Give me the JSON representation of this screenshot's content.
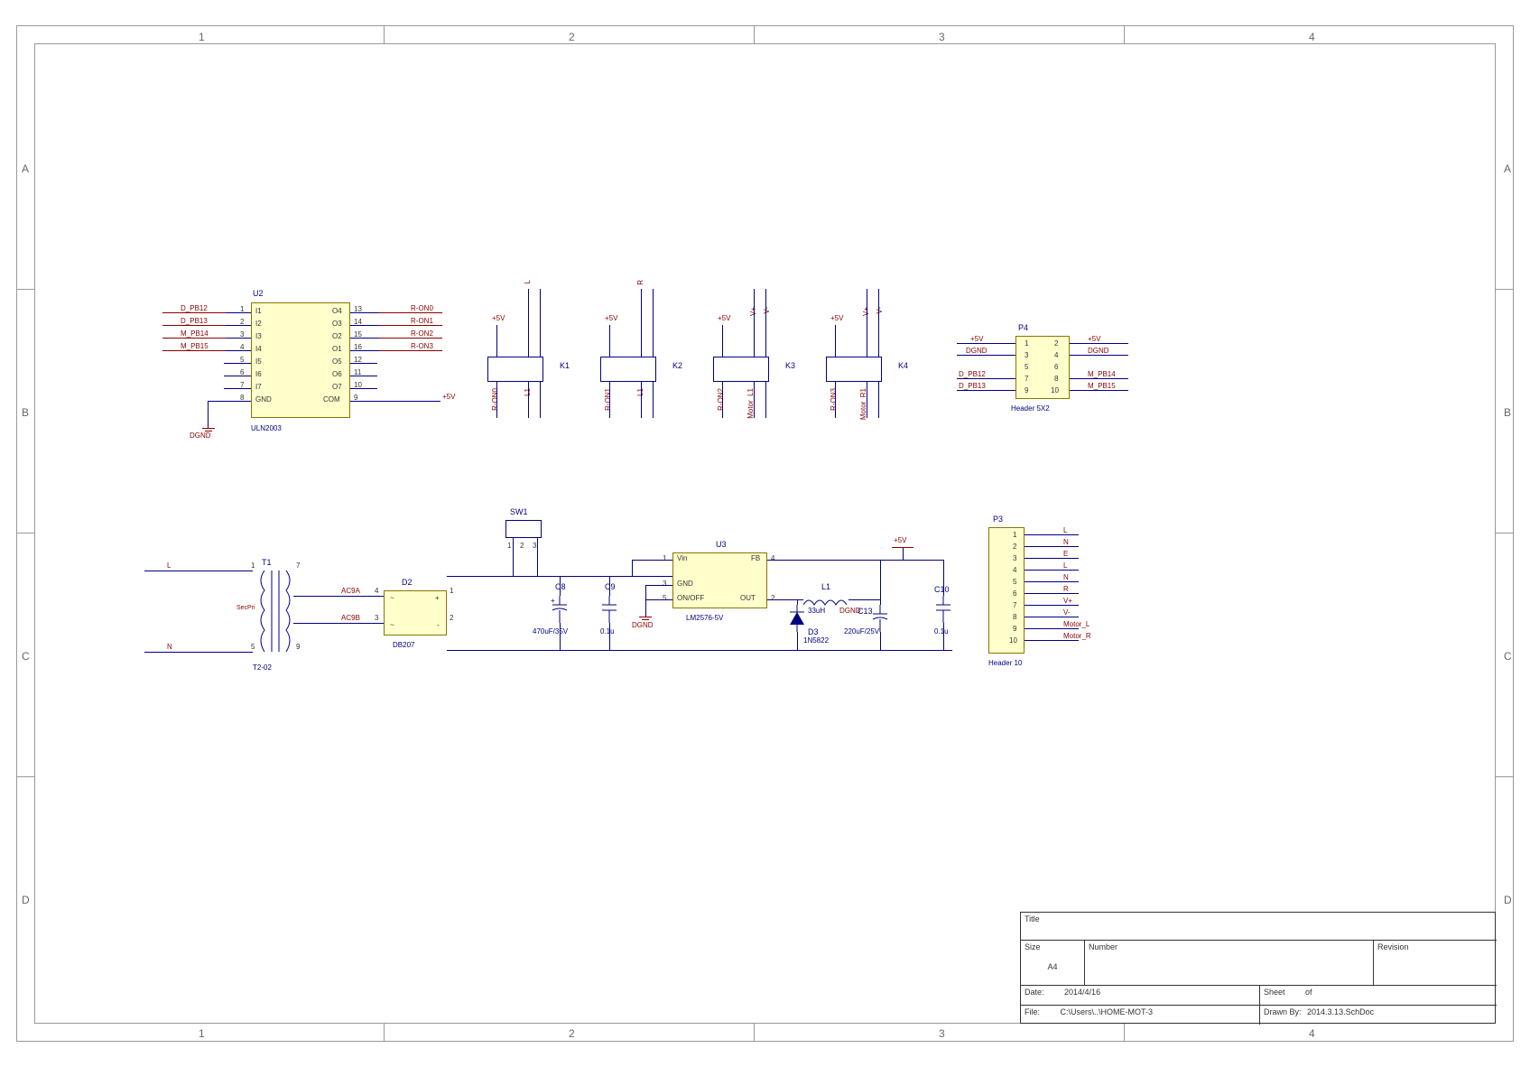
{
  "frame": {
    "cols": [
      "1",
      "2",
      "3",
      "4"
    ],
    "rows": [
      "A",
      "B",
      "C",
      "D"
    ]
  },
  "u2": {
    "ref": "U2",
    "val": "ULN2003",
    "left_pins": [
      {
        "n": "1",
        "lbl": "I1"
      },
      {
        "n": "2",
        "lbl": "I2"
      },
      {
        "n": "3",
        "lbl": "I3"
      },
      {
        "n": "4",
        "lbl": "I4"
      },
      {
        "n": "5",
        "lbl": "I5"
      },
      {
        "n": "6",
        "lbl": "I6"
      },
      {
        "n": "7",
        "lbl": "I7"
      },
      {
        "n": "8",
        "lbl": "GND"
      }
    ],
    "right_pins": [
      {
        "n": "13",
        "lbl": "O4"
      },
      {
        "n": "14",
        "lbl": "O3"
      },
      {
        "n": "15",
        "lbl": "O2"
      },
      {
        "n": "16",
        "lbl": "O1"
      },
      {
        "n": "12",
        "lbl": "O5"
      },
      {
        "n": "11",
        "lbl": "O6"
      },
      {
        "n": "10",
        "lbl": "O7"
      },
      {
        "n": "9",
        "lbl": "COM"
      }
    ],
    "left_nets": [
      "D_PB12",
      "D_PB13",
      "M_PB14",
      "M_PB15",
      "",
      "",
      "",
      ""
    ],
    "right_nets": [
      "R-ON0",
      "R-ON1",
      "R-ON2",
      "R-ON3",
      "",
      "",
      "",
      "+5V"
    ],
    "gnd_net": "DGND"
  },
  "relays": [
    {
      "ref": "K1",
      "ctrl": "R-ON0",
      "out1": "L1",
      "out2": "L1",
      "top1": "L",
      "pow": "+5V"
    },
    {
      "ref": "K2",
      "ctrl": "R-ON1",
      "out1": "L1",
      "out2": "L1",
      "top1": "R",
      "pow": "+5V"
    },
    {
      "ref": "K3",
      "ctrl": "R-ON2",
      "out1": "Motor_L1",
      "out2": "",
      "top1": "V+",
      "top2": "V-",
      "pow": "+5V"
    },
    {
      "ref": "K4",
      "ctrl": "R-ON3",
      "out1": "Motor_R1",
      "out2": "",
      "top1": "V+",
      "top2": "V-",
      "pow": "+5V"
    }
  ],
  "p4": {
    "ref": "P4",
    "val": "Header 5X2",
    "pins": [
      [
        "1",
        "2"
      ],
      [
        "3",
        "4"
      ],
      [
        "5",
        "6"
      ],
      [
        "7",
        "8"
      ],
      [
        "9",
        "10"
      ]
    ],
    "left_nets": [
      "+5V",
      "DGND",
      "",
      "D_PB12",
      "D_PB13"
    ],
    "right_nets": [
      "+5V",
      "DGND",
      "",
      "M_PB14",
      "M_PB15"
    ]
  },
  "t1": {
    "ref": "T1",
    "val": "T2-02",
    "pins": [
      "1",
      "5",
      "7",
      "9"
    ],
    "left_nets": [
      "L",
      "N"
    ],
    "sec": "SecPri",
    "r_nets": [
      "AC9A",
      "AC9B"
    ],
    "rp": [
      "4",
      "3"
    ]
  },
  "d2": {
    "ref": "D2",
    "val": "DB207",
    "pins": [
      "1",
      "2",
      "3",
      "4"
    ]
  },
  "sw1": {
    "ref": "SW1",
    "pins": [
      "1",
      "2",
      "3"
    ]
  },
  "c8": {
    "ref": "C8",
    "val": "470uF/35V"
  },
  "c9": {
    "ref": "C9",
    "val": "0.1u"
  },
  "u3": {
    "ref": "U3",
    "val": "LM2576-5V",
    "pins": [
      {
        "n": "1",
        "lbl": "Vin"
      },
      {
        "n": "4",
        "lbl": "FB"
      },
      {
        "n": "3",
        "lbl": "GND"
      },
      {
        "n": "5",
        "lbl": "ON/OFF"
      },
      {
        "n": "2",
        "lbl": "OUT"
      }
    ],
    "gnd": "DGND"
  },
  "l1": {
    "ref": "L1",
    "val": "33uH"
  },
  "d3": {
    "ref": "D3",
    "val": "1N5822"
  },
  "c13": {
    "ref": "C13",
    "val": "220uF/25V"
  },
  "c10": {
    "ref": "C10",
    "val": "0.1u"
  },
  "pow5v": "+5V",
  "dgnd": "DGND",
  "p3": {
    "ref": "P3",
    "val": "Header 10",
    "pins": [
      "1",
      "2",
      "3",
      "4",
      "5",
      "6",
      "7",
      "8",
      "9",
      "10"
    ],
    "nets": [
      "L",
      "N",
      "E",
      "L",
      "N",
      "R",
      "V+",
      "V-",
      "Motor_L",
      "Motor_R"
    ]
  },
  "titleblock": {
    "title_lbl": "Title",
    "size_lbl": "Size",
    "size": "A4",
    "num_lbl": "Number",
    "rev_lbl": "Revision",
    "date_lbl": "Date:",
    "date": "2014/4/16",
    "sheet_lbl": "Sheet",
    "of": "of",
    "file_lbl": "File:",
    "file": "C:\\Users\\..\\HOME-MOT-3",
    "drawn_lbl": "Drawn By:",
    "drawn": "2014.3.13.SchDoc"
  }
}
